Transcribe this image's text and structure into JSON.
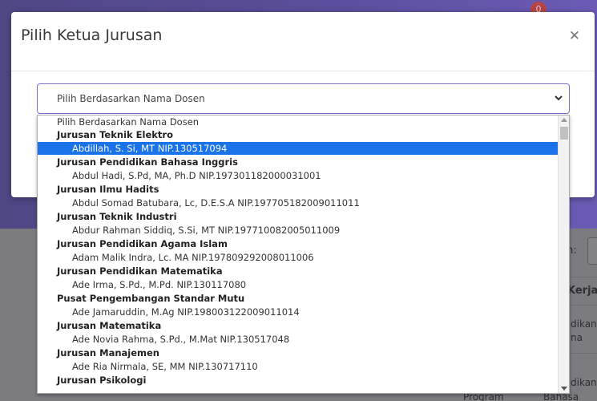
{
  "background": {
    "notification_count": "0",
    "search_label": "ch:",
    "column_header": "Kerja",
    "cell_1a": "dikan",
    "cell_1b": "na",
    "cell_2a": "dikan",
    "footer_col_1": "Program",
    "footer_col_2": "Bahasa"
  },
  "modal": {
    "title": "Pilih Ketua Jurusan",
    "close_icon": "close-icon",
    "select_value": "Pilih Berdasarkan Nama Dosen"
  },
  "dropdown": {
    "placeholder": "Pilih Berdasarkan Nama Dosen",
    "groups": [
      {
        "label": "Jurusan Teknik Elektro",
        "option": "Abdillah, S. Si, MT NIP.130517094",
        "selected": true
      },
      {
        "label": "Jurusan Pendidikan Bahasa Inggris",
        "option": "Abdul Hadi, S.Pd, MA, Ph.D NIP.197301182000031001"
      },
      {
        "label": "Jurusan Ilmu Hadits",
        "option": "Abdul Somad Batubara, Lc, D.E.S.A NIP.197705182009011011"
      },
      {
        "label": "Jurusan Teknik Industri",
        "option": "Abdur Rahman Siddiq, S.Si, MT NIP.197710082005011009"
      },
      {
        "label": "Jurusan Pendidikan Agama Islam",
        "option": "Adam Malik Indra, Lc. MA NIP.197809292008011006"
      },
      {
        "label": "Jurusan Pendidikan Matematika",
        "option": "Ade Irma, S.Pd., M.Pd. NIP.130117080"
      },
      {
        "label": "Pusat Pengembangan Standar Mutu",
        "option": "Ade Jamaruddin, M.Ag NIP.198003122009011014"
      },
      {
        "label": "Jurusan Matematika",
        "option": "Ade Novia Rahma, S.Pd., M.Mat NIP.130517048"
      },
      {
        "label": "Jurusan Manajemen",
        "option": "Ade Ria Nirmala, SE, MM NIP.130717110"
      },
      {
        "label": "Jurusan Psikologi",
        "option": ""
      }
    ]
  },
  "colors": {
    "selected_bg": "#1a73e8",
    "select_border": "#7b6fc9",
    "header_bg": "#5b4e9c"
  }
}
